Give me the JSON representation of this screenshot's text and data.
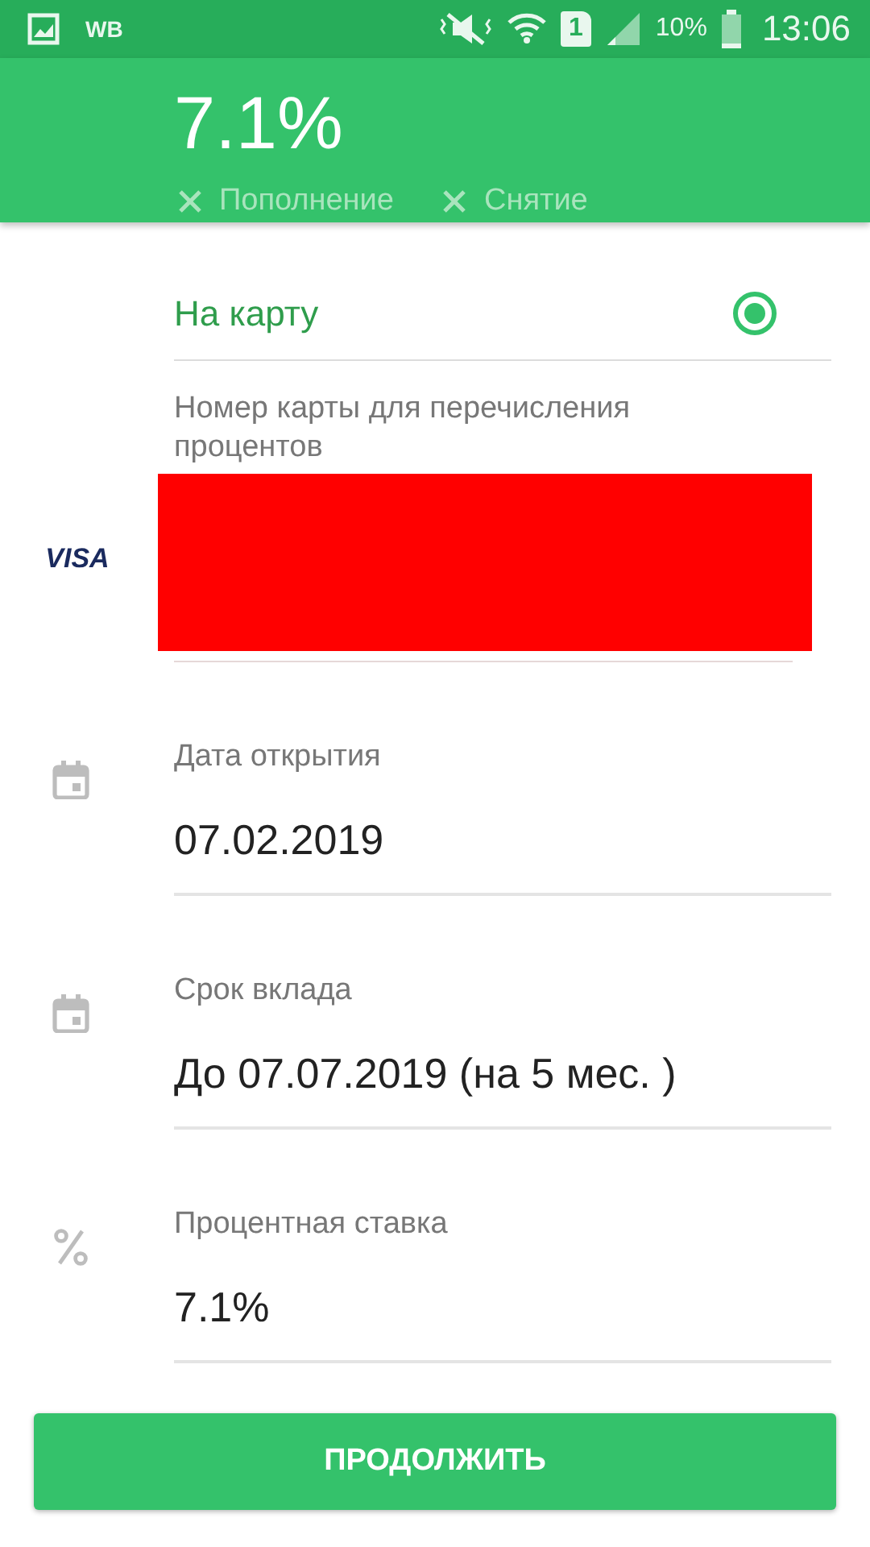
{
  "status_bar": {
    "app_label": "WB",
    "sim": "1",
    "battery": "10%",
    "time": "13:06"
  },
  "header": {
    "rate": "7.1%",
    "options": [
      {
        "label": "Пополнение"
      },
      {
        "label": "Снятие"
      }
    ]
  },
  "payout": {
    "options": [
      {
        "label": "На карту",
        "selected": true
      }
    ]
  },
  "card": {
    "label": "Номер карты для перечисления процентов",
    "brand": "VISA"
  },
  "fields": [
    {
      "kind": "date",
      "label": "Дата открытия",
      "value": "07.02.2019"
    },
    {
      "kind": "date",
      "label": "Срок вклада",
      "value": "До 07.07.2019 (на 5 мес. )"
    },
    {
      "kind": "percent",
      "label": "Процентная ставка",
      "value": "7.1%"
    }
  ],
  "button": "ПРОДОЛЖИТЬ"
}
